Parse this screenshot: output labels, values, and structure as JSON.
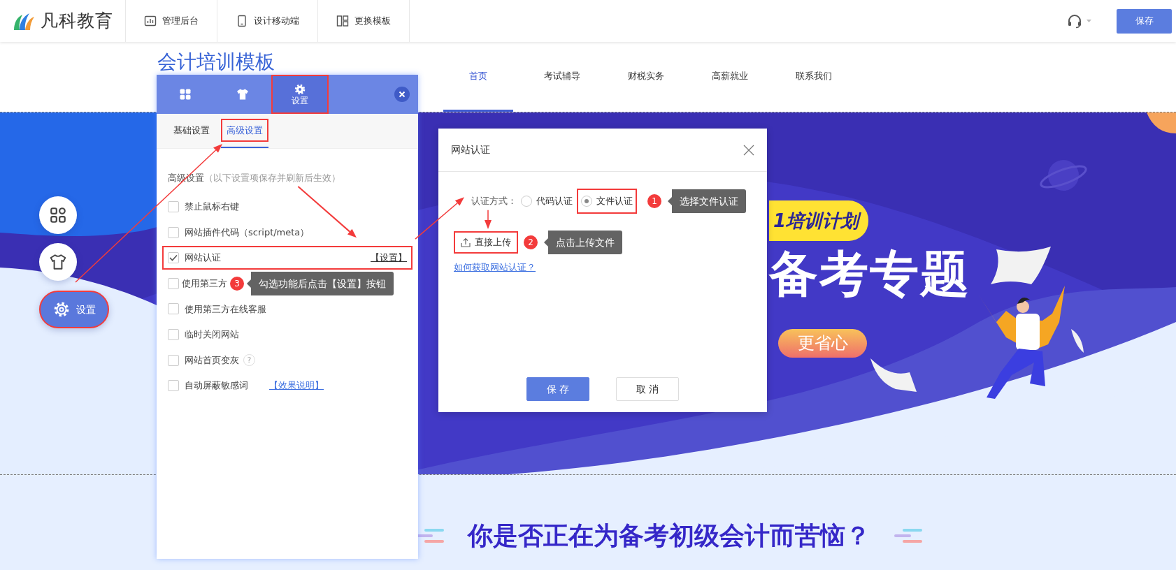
{
  "top_bar": {
    "logo_text": "凡科教育",
    "menu": [
      {
        "kind": "chart",
        "label": "管理后台"
      },
      {
        "kind": "phone",
        "label": "设计移动端"
      },
      {
        "kind": "layout",
        "label": "更换模板"
      }
    ],
    "save_button": "保存"
  },
  "site": {
    "title": "会计培训模板",
    "nav": [
      {
        "label": "首页",
        "selected": true
      },
      {
        "label": "考试辅导",
        "selected": false
      },
      {
        "label": "财税实务",
        "selected": false
      },
      {
        "label": "高薪就业",
        "selected": false
      },
      {
        "label": "联系我们",
        "selected": false
      }
    ]
  },
  "banner": {
    "tagline": "1培训计划",
    "headline": "备考专题",
    "cta": "更省心"
  },
  "section_heading": "你是否正在为备考初级会计而苦恼？",
  "floating_tools": [
    {
      "kind": "grid",
      "selected": false,
      "highlighted": false
    },
    {
      "kind": "shirt",
      "selected": false,
      "highlighted": false
    },
    {
      "kind": "settings",
      "label": "设置",
      "selected": true,
      "highlighted": true
    }
  ],
  "settings_panel": {
    "tabs": [
      {
        "kind": "grid",
        "selected": false,
        "highlighted": false
      },
      {
        "kind": "shirt",
        "selected": false,
        "highlighted": false
      },
      {
        "kind": "settings",
        "label": "设置",
        "selected": true,
        "highlighted": true
      }
    ],
    "subtabs": [
      {
        "label": "基础设置",
        "selected": false,
        "highlighted": false
      },
      {
        "label": "高级设置",
        "selected": true,
        "highlighted": true
      }
    ],
    "section_title": "高级设置",
    "section_note": "（以下设置项保存并刷新后生效）",
    "options": [
      {
        "label": "禁止鼠标右键",
        "checked": false,
        "highlighted": false
      },
      {
        "label": "网站插件代码（script/meta）",
        "checked": false,
        "highlighted": false
      },
      {
        "label": "网站认证",
        "checked": true,
        "highlighted": true,
        "action": "【设置】"
      },
      {
        "label": "使用第三方",
        "checked": false,
        "highlighted": false,
        "step": "3",
        "tip": "勾选功能后点击【设置】按钮"
      },
      {
        "label": "使用第三方在线客服",
        "checked": false,
        "highlighted": false
      },
      {
        "label": "临时关闭网站",
        "checked": false,
        "highlighted": false
      },
      {
        "label": "网站首页变灰",
        "checked": false,
        "highlighted": false,
        "help": "?"
      },
      {
        "label": "自动屏蔽敏感词",
        "checked": false,
        "highlighted": false,
        "link": "【效果说明】"
      }
    ]
  },
  "dialog": {
    "title": "网站认证",
    "method_label": "认证方式：",
    "methods": [
      {
        "label": "代码认证",
        "selected": false,
        "highlighted": false
      },
      {
        "label": "文件认证",
        "selected": true,
        "highlighted": true,
        "step": "1",
        "tip": "选择文件认证"
      }
    ],
    "upload_button": {
      "label": "直接上传",
      "highlighted": true,
      "step": "2",
      "tip": "点击上传文件"
    },
    "help_link": "如何获取网站认证？",
    "buttons": [
      {
        "label": "保 存",
        "kind": "primary"
      },
      {
        "label": "取 消",
        "kind": "secondary"
      }
    ]
  }
}
